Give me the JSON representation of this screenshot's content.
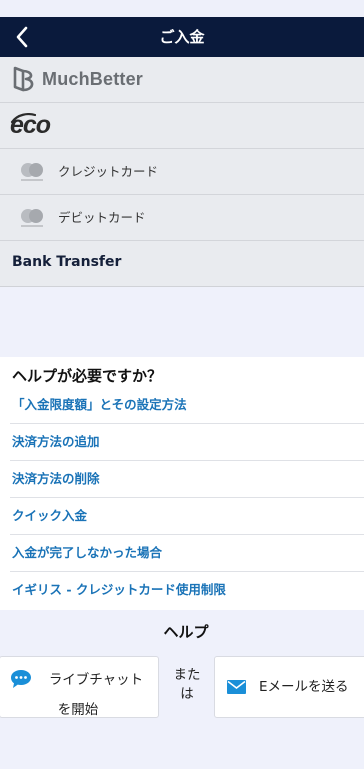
{
  "header": {
    "title": "ご入金"
  },
  "methods": {
    "muchbetter": {
      "logo_text": "MuchBetter"
    },
    "eco": {
      "logo_text": "eco"
    },
    "credit_card": {
      "label": "クレジットカード"
    },
    "debit_card": {
      "label": "デビットカード"
    },
    "bank_transfer": {
      "label": "Bank Transfer"
    }
  },
  "help": {
    "heading": "ヘルプが必要ですか？",
    "links": [
      "「入金限度額」とその設定方法",
      "決済方法の追加",
      "決済方法の削除",
      "クイック入金",
      "入金が完了しなかった場合",
      "イギリス - クレジットカード使用制限"
    ]
  },
  "contact": {
    "title": "ヘルプ",
    "live_chat_line1": "ライブチャット",
    "live_chat_line2": "を開始",
    "or_line1": "また",
    "or_line2": "は",
    "email": "Eメールを送る"
  },
  "colors": {
    "header_bg": "#0a1a3c",
    "link": "#1a73b7",
    "icon_blue": "#1a8fd8"
  }
}
